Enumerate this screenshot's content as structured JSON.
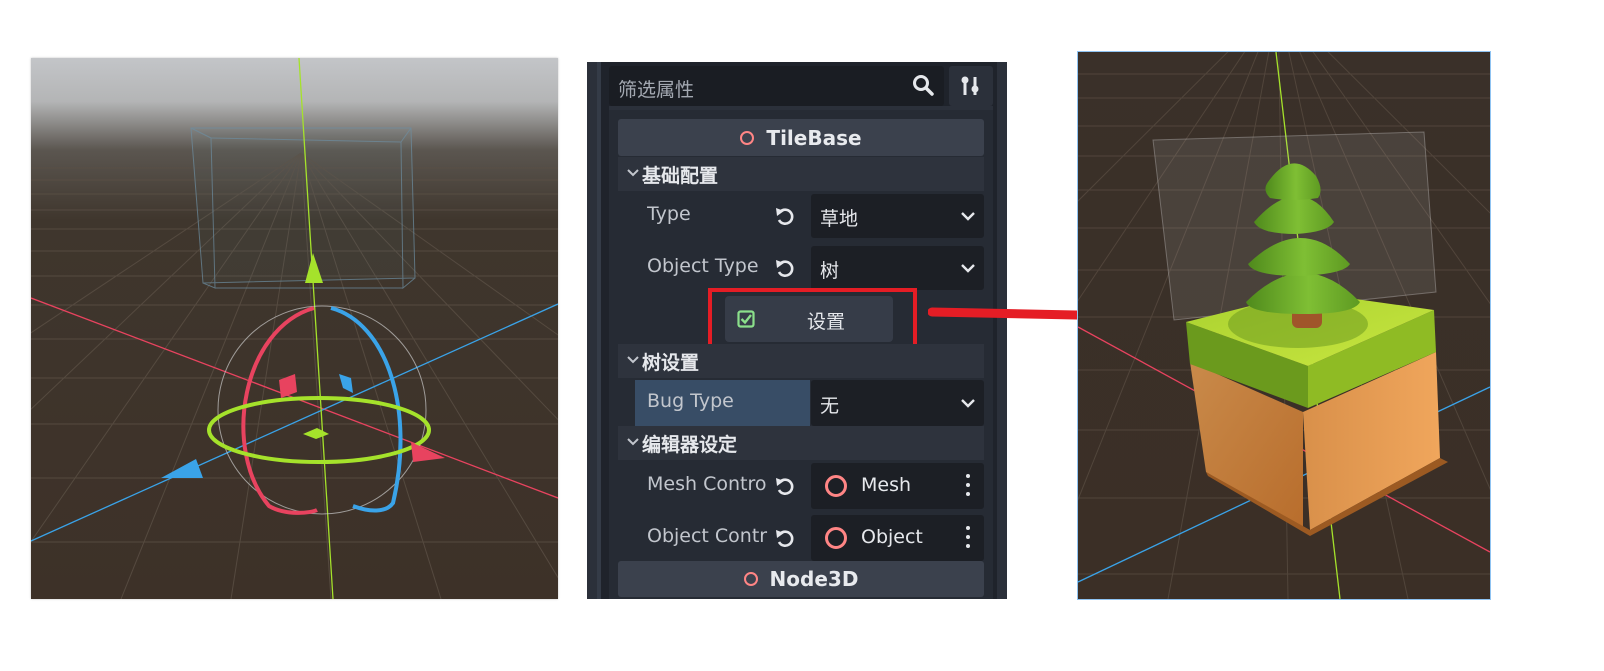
{
  "inspector": {
    "filter_placeholder": "筛选属性",
    "tools_icon": "tools-icon",
    "search_icon": "search-icon",
    "class_tilebase": "TileBase",
    "sections": {
      "basic": "基础配置",
      "tree": "树设置",
      "editor": "编辑器设定"
    },
    "props": {
      "type_label": "Type",
      "type_value": "草地",
      "object_type_label": "Object Type",
      "object_type_value": "树",
      "set_button": "设置",
      "bug_type_label": "Bug Type",
      "bug_type_value": "无",
      "mesh_control_label": "Mesh Contro",
      "mesh_control_value": "Mesh",
      "object_control_label": "Object Contr",
      "object_control_value": "Object"
    },
    "class_node3d": "Node3D"
  },
  "colors": {
    "panel_bg": "#1f232b",
    "highlight_red": "#e51d25",
    "resource_ring": "#ff8585",
    "axis_x": "#e8435f",
    "axis_y": "#a5e22b",
    "axis_z": "#3aa3e8",
    "ground": "#3b3128"
  }
}
